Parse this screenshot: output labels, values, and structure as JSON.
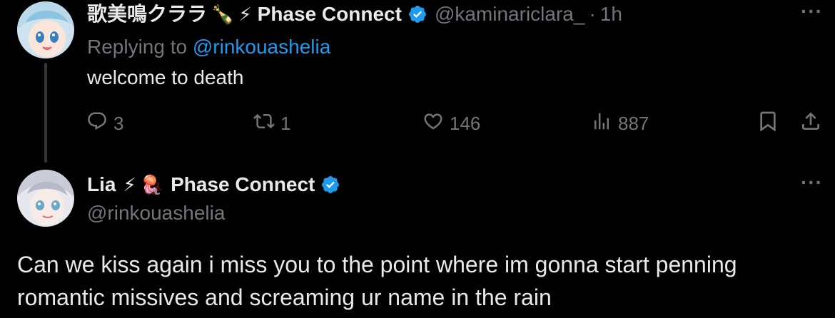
{
  "reply_tweet": {
    "display_name": "歌美鳴クララ",
    "emojis": [
      "🍾",
      "⚡"
    ],
    "affiliation": "Phase Connect",
    "handle": "@kaminariclara_",
    "separator": "·",
    "time": "1h",
    "replying_prefix": "Replying to ",
    "replying_to": "@rinkouashelia",
    "text": "welcome to death",
    "stats": {
      "replies": "3",
      "retweets": "1",
      "likes": "146",
      "views": "887"
    },
    "more_label": "···"
  },
  "main_tweet": {
    "display_name": "Lia",
    "emojis": [
      "⚡",
      "🪼"
    ],
    "affiliation": "Phase Connect",
    "handle": "@rinkouashelia",
    "text": "Can we kiss again i miss you to the point where im gonna start penning romantic missives and screaming ur name in the rain",
    "more_label": "···"
  },
  "icons": {
    "verified": "verified-badge-icon",
    "reply": "reply-icon",
    "retweet": "retweet-icon",
    "like": "heart-icon",
    "views": "views-icon",
    "bookmark": "bookmark-icon",
    "share": "share-icon"
  },
  "colors": {
    "background": "#000000",
    "text": "#e7e9ea",
    "muted": "#71767b",
    "accent": "#1d9bf0"
  }
}
